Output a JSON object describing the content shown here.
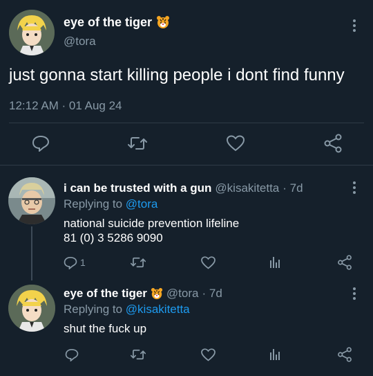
{
  "main_tweet": {
    "display_name": "eye of the tiger",
    "handle": "@tora",
    "text": "just gonna start killing people i dont find funny",
    "timestamp": "12:12 AM · 01 Aug 24"
  },
  "replies": [
    {
      "display_name": "i can be trusted with a gun",
      "handle": "@kisakitetta",
      "age": "· 7d",
      "replying_label": "Replying to",
      "replying_to": "@tora",
      "text_lines": [
        "national suicide prevention lifeline",
        "81 (0) 3 5286 9090"
      ],
      "reply_count": "1"
    },
    {
      "display_name": "eye of the tiger",
      "handle": "@tora",
      "age": "· 7d",
      "replying_label": "Replying to",
      "replying_to": "@kisakitetta",
      "text_lines": [
        "shut the fuck up"
      ],
      "reply_count": ""
    }
  ],
  "icons": {
    "more": "more-vertical-icon",
    "reply": "reply-icon",
    "retweet": "retweet-icon",
    "like": "heart-icon",
    "share": "share-icon",
    "stats": "stats-icon",
    "tiger": "tiger-emoji-icon"
  },
  "colors": {
    "background": "#15202b",
    "text": "#ffffff",
    "muted": "#8899a6",
    "link": "#1d9bf0",
    "divider": "#2f3b47"
  }
}
